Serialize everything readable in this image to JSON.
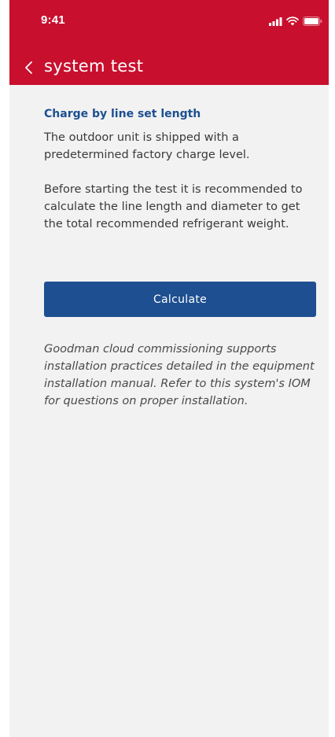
{
  "status_bar": {
    "time": "9:41"
  },
  "header": {
    "title": "system test",
    "back_icon": "chevron-left-icon",
    "background_color": "#c8102e"
  },
  "content": {
    "heading": "Charge by line set length",
    "paragraphs": [
      "The outdoor unit is shipped with a predetermined factory charge level.",
      "Before starting the test it is recommended to calculate the line length and diameter to get the total recommended refrigerant weight."
    ],
    "calculate_label": "Calculate",
    "disclaimer": "Goodman cloud commissioning supports installation practices detailed in the equipment installation manual. Refer to this system's IOM for questions on proper installation."
  },
  "colors": {
    "accent": "#1d4f91",
    "background": "#f2f2f2"
  }
}
